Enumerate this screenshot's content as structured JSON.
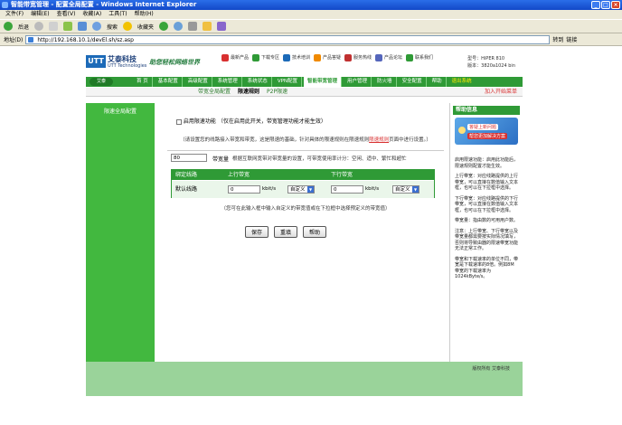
{
  "window": {
    "title": "智能带宽管理 - 配置全局配置 - Windows Internet Explorer"
  },
  "menu": [
    "文件(F)",
    "编辑(E)",
    "查看(V)",
    "收藏(A)",
    "工具(T)",
    "帮助(H)"
  ],
  "toolbar": {
    "back": "后退",
    "search": "搜索",
    "favorites": "收藏夹"
  },
  "address": {
    "label": "地址(D)",
    "url": "http://192.168.10.1/devEl.sh/sz.asp",
    "go": "转到",
    "links": "链接"
  },
  "header": {
    "logo": "UTT",
    "brand": "艾泰科技",
    "brand_sub": "UTT Technologies",
    "slogan": "助您轻松网络世界",
    "icons": [
      {
        "name": "product",
        "label": "最新产品"
      },
      {
        "name": "download",
        "label": "下载专区"
      },
      {
        "name": "training",
        "label": "技术培训"
      },
      {
        "name": "faq",
        "label": "产品答疑"
      },
      {
        "name": "hotline",
        "label": "服务热线"
      },
      {
        "name": "forum",
        "label": "产品论坛"
      },
      {
        "name": "contact",
        "label": "联系我们"
      }
    ],
    "model": "型号：HiPER 810",
    "version": "版本：3820a1024 bin"
  },
  "nav": {
    "logo": "艾泰",
    "items": [
      "首 页",
      "基本配置",
      "高级配置",
      "系统管理",
      "系统状态",
      "VPN配置",
      "智能带宽管理",
      "用户管理",
      "防火墙",
      "安全配置",
      "帮助"
    ],
    "active": 6,
    "logout": "退出系统"
  },
  "subnav": {
    "tabs": [
      "带宽全局配置",
      "限速规则",
      "P2P限速"
    ],
    "active": 1,
    "wizard": "加入开始菜单"
  },
  "left": {
    "title": "限速全局配置"
  },
  "main": {
    "enable_label": "启用限速功能",
    "enable_note": "（仅在启用此开关，带宽管理功能才能生效）",
    "note_pre": "（请设置您的线路接入带宽和带宽，这是限速的基础，针对具体的限速规则在限速规则",
    "note_link": "限速规则",
    "note_post": "页面中进行设置。）",
    "rate_value": "80",
    "rate_label": "带宽量",
    "rate_desc": "根据互联网宽带对带宽量的设置，可带宽使用率计分：空闲、适中、繁忙和超忙",
    "table": {
      "headers": [
        "绑定线路",
        "上行带宽",
        "下行带宽"
      ],
      "row_label": "默认线路",
      "up_value": "0",
      "down_value": "0",
      "unit": "kbit/s",
      "select": "自定义"
    },
    "hint": "（您可在此输入框中输入自定义的带宽值或在下拉框中选择预定义的带宽值）",
    "buttons": [
      "保存",
      "重填",
      "帮助"
    ]
  },
  "help": {
    "title": "帮助信息",
    "banner1": "答疑上新问题",
    "banner2": "帮您更加解决方案",
    "paragraphs": [
      "启用限速功能：启用此功能后，限速规则配置才能生效。",
      "上行带宽：对应线路提供的上行带宽，可以直接在数值输入文本框，也可以在下拉框中选择。",
      "下行带宽：对应线路提供的下行带宽，可以直接在数值输入文本框，也可以在下拉框中选择。",
      "带宽量：指由数的可用用户数。",
      "注意：上行带宽、下行带宽以及带宽量都需要按实际情况填写，否则将导致由器的限速带宽功能无法正常工作。",
      "带宽和下载速率的单位不同，带宽是下载速率的8倍。例如8M带宽的下载速率为1024kByte/s。"
    ]
  },
  "footer": {
    "copyright": "版权所有 艾泰科技"
  }
}
